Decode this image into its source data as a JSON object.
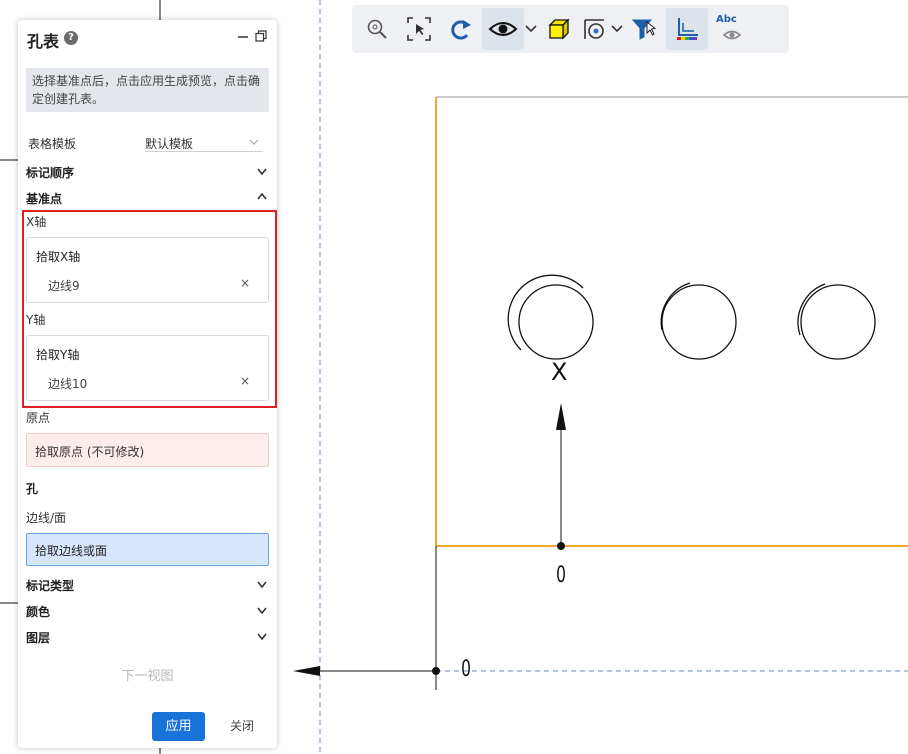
{
  "panel": {
    "title": "孔表",
    "help_icon": "help-icon",
    "info_text": "选择基准点后，点击应用生成预览，点击确定创建孔表。",
    "template_label": "表格模板",
    "template_value": "默认模板",
    "mark_order": "标记顺序",
    "datum": "基准点",
    "x_axis": "X轴",
    "pick_x": "拾取X轴",
    "x_value": "边线9",
    "y_axis": "Y轴",
    "pick_y": "拾取Y轴",
    "y_value": "边线10",
    "clear": "×",
    "origin": "原点",
    "pick_origin": "拾取原点 (不可修改)",
    "hole": "孔",
    "edge_face": "边线/面",
    "pick_edge": "拾取边线或面",
    "mark_type": "标记类型",
    "color": "颜色",
    "layer": "图层",
    "next_view": "下一视图",
    "apply": "应用",
    "close": "关闭"
  },
  "toolbar": {
    "icons": [
      "zoom-icon",
      "zoom-selection-icon",
      "redo-icon",
      "eye-icon",
      "cube-icon",
      "section-view-icon",
      "filter-select-icon",
      "axis-color-icon",
      "annotation-visibility-icon"
    ],
    "annotation_text": "Abc"
  },
  "canvas": {
    "x_marker": "X",
    "zero_marker_vertical": "0",
    "zero_marker_horizontal": "0",
    "colors": {
      "part_edge": "#f0a830",
      "dashed": "#6b86c8",
      "line": "#111111"
    }
  }
}
